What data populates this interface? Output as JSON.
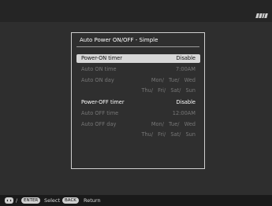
{
  "dialog": {
    "title": "Auto Power ON/OFF - Simple",
    "rows": [
      {
        "label": "Power-ON timer",
        "value": "Disable"
      },
      {
        "label": "Auto ON time",
        "value": "7:00AM"
      },
      {
        "label": "Auto ON day",
        "days1": "Mon/ Tue/ Wed",
        "days2": "Thu/ Fri/ Sat/ Sun"
      },
      {
        "label": "Power-OFF timer",
        "value": "Disable"
      },
      {
        "label": "Auto OFF time",
        "value": "12:00AM"
      },
      {
        "label": "Auto OFF day",
        "days1": "Mon/ Tue/ Wed",
        "days2": "Thu/ Fri/ Sat/ Sun"
      }
    ]
  },
  "footer": {
    "separator": "/",
    "enter_key": "ENTER",
    "select_label": "Select",
    "back_key": "BACK",
    "return_label": "Return"
  },
  "icons": {
    "dpad": "dpad-icon",
    "battery": "battery-icon"
  }
}
